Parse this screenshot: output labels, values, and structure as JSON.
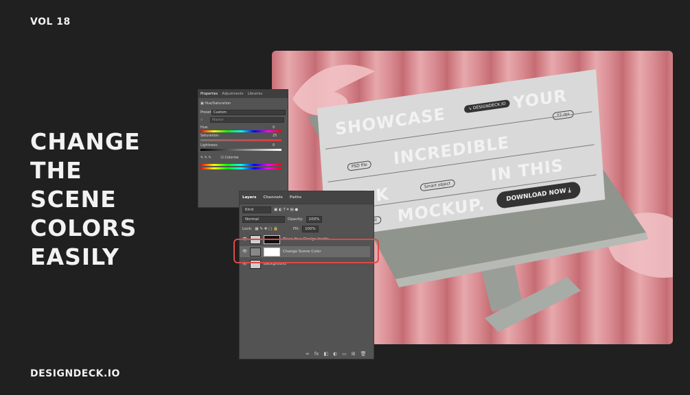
{
  "header": {
    "vol": "VOL 18"
  },
  "headline": [
    "CHANGE",
    "THE",
    "SCENE",
    "COLORS",
    "EASILY"
  ],
  "footer": {
    "brand": "DESIGNDECK.IO"
  },
  "mockup": {
    "line1a": "SHOWCASE",
    "line1pill": "↘ DESIGNDECK.IO",
    "line1b": "YOUR",
    "dpi": "72 dpi",
    "line2pill": "PSD file",
    "line2": "INCREDIBLE",
    "line3a": "WORK",
    "line3pill": "Smart object",
    "line3b": "IN THIS",
    "line4pill": "Easy to edit",
    "line4": "MOCKUP.",
    "download": "DOWNLOAD NOW ⤓"
  },
  "properties": {
    "tabs": [
      "Properties",
      "Adjustments",
      "Libraries"
    ],
    "title": "Hue/Saturation",
    "preset_label": "Preset:",
    "preset_value": "Custom",
    "channel_value": "Master",
    "hue_label": "Hue:",
    "hue_value": "0",
    "sat_label": "Saturation:",
    "sat_value": "25",
    "light_label": "Lightness:",
    "light_value": "0",
    "colorize": "Colorize"
  },
  "layers": {
    "tabs": [
      "Layers",
      "Channels",
      "Paths"
    ],
    "kind": "Kind",
    "blend": "Normal",
    "opacity_label": "Opacity:",
    "opacity_value": "100%",
    "lock_label": "Lock:",
    "fill_label": "Fill:",
    "fill_value": "100%",
    "items": [
      {
        "name": "Place Your Design Inside"
      },
      {
        "name": "Change Scene Color"
      },
      {
        "name": "Background"
      }
    ],
    "footer_icons": [
      "∞",
      "fx",
      "◧",
      "◐",
      "▭",
      "⊞",
      "🗑"
    ]
  },
  "colors": {
    "bg": "#202020",
    "scene": "#d98c92",
    "highlight": "#e04848",
    "panel": "#535353"
  }
}
